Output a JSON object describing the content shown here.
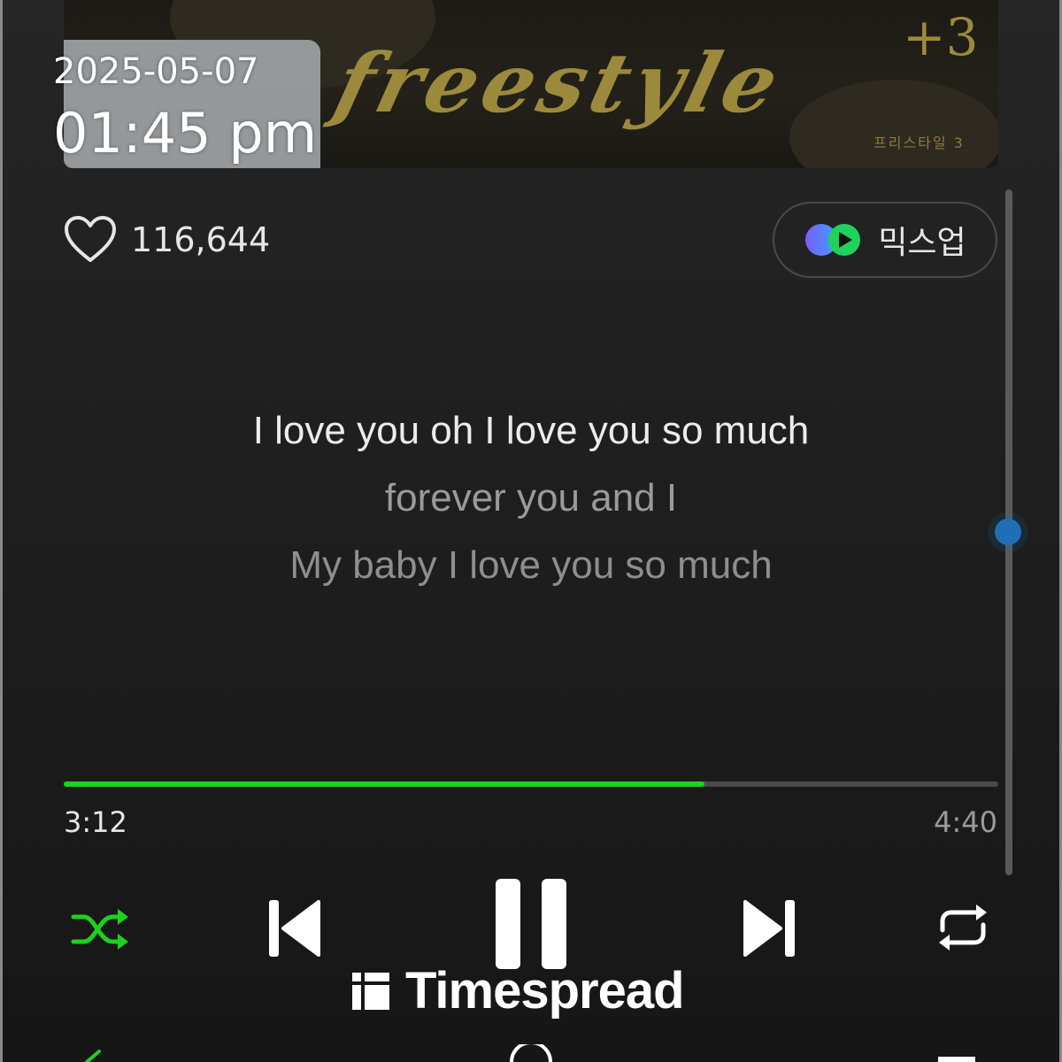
{
  "album_art": {
    "title_text": "freestyle",
    "edition": "+3",
    "subtitle_korean": "프리스타일 3"
  },
  "overlay": {
    "date": "2025-05-07",
    "time": "01:45 pm"
  },
  "like": {
    "icon": "heart-outline-icon",
    "count": "116,644"
  },
  "mixup": {
    "icon": "mixup-logo-icon",
    "label": "믹스업"
  },
  "lyrics": {
    "current": "I love you oh I love you so much",
    "next_1": "forever you and I",
    "next_2": "My baby I love you so much"
  },
  "playback": {
    "elapsed": "3:12",
    "total": "4:40",
    "progress_fraction": 0.686
  },
  "controls": {
    "shuffle_icon": "shuffle-icon",
    "previous_icon": "skip-previous-icon",
    "pause_icon": "pause-icon",
    "next_icon": "skip-next-icon",
    "repeat_icon": "repeat-icon"
  },
  "colors": {
    "accent_green": "#1ed11e",
    "scroll_thumb": "#1e6fb8",
    "album_gold": "#9b8a3c"
  },
  "watermark": {
    "text": "Timespread"
  }
}
